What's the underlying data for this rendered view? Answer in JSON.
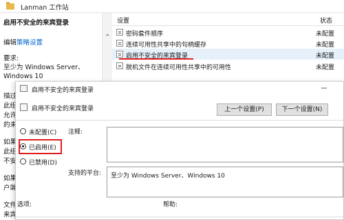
{
  "window": {
    "title": "Lanman 工作站"
  },
  "left_panel": {
    "heading": "启用不安全的来宾登录",
    "edit_prefix": "编辑",
    "edit_link": "策略设置",
    "requirements_label": "要求:",
    "requirements_line1": "至少为 Windows Server、",
    "requirements_line2": "Windows 10",
    "cut_1": "描过",
    "cut_2": "此组",
    "cut_3": "允许",
    "cut_4": "的未",
    "cut_5": "如果",
    "cut_6": "此组",
    "cut_7": "不安",
    "cut_8": "如果",
    "cut_9": "户端",
    "cut_10": "文件",
    "cut_11": "来宾"
  },
  "list": {
    "col_setting": "设置",
    "col_state": "状态",
    "rows": [
      {
        "name": "密码套件顺序",
        "state": "未配置"
      },
      {
        "name": "连续可用性共享中的句柄缓存",
        "state": "未配置"
      },
      {
        "name": "启用不安全的来宾登录",
        "state": "未配置"
      },
      {
        "name": "脱机文件在连续可用性共享中的可用性",
        "state": "未配置"
      }
    ]
  },
  "dialog": {
    "title": "启用不安全的来宾登录",
    "policy_name": "启用不安全的来宾登录",
    "prev_button": "上一个设置(P)",
    "next_button": "下一个设置(N)",
    "radio_not_configured": "未配置(C)",
    "radio_enabled": "已启用(E)",
    "radio_disabled": "已禁用(D)",
    "selected": "enabled",
    "comment_label": "注释:",
    "comment_value": "",
    "platform_label": "支持的平台:",
    "platform_value": "至少为 Windows Server、Windows 10",
    "options_label": "选项:",
    "help_label": "帮助:"
  }
}
